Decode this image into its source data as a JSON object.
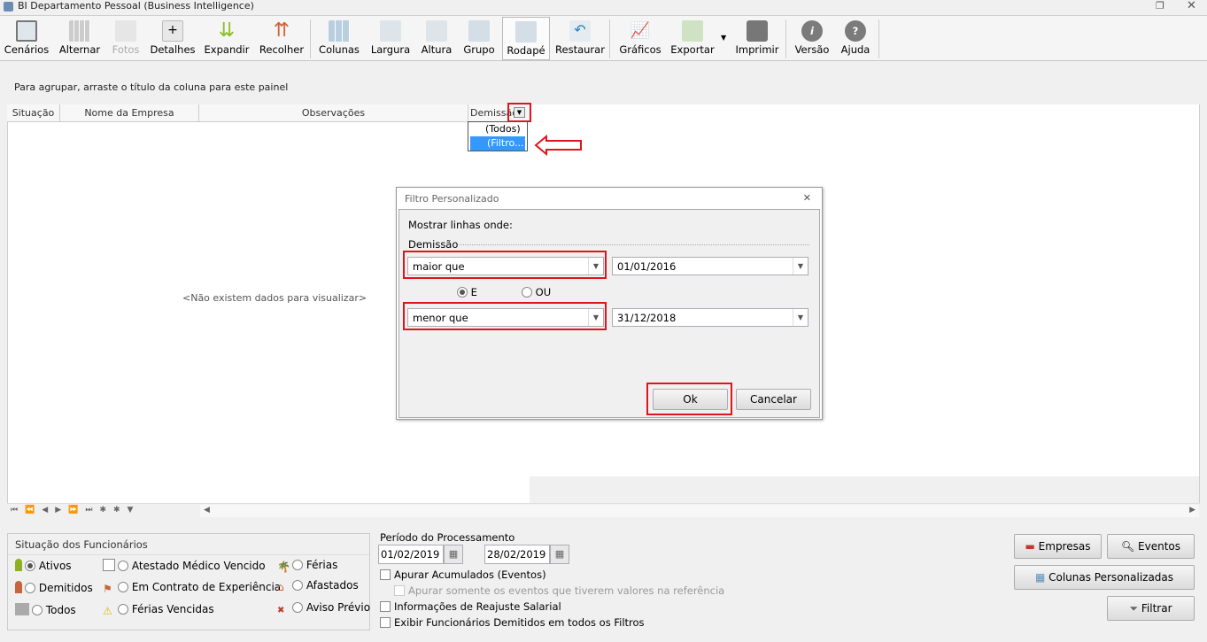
{
  "window": {
    "title": "BI Departamento Pessoal  (Business Intelligence)"
  },
  "toolbar": [
    {
      "label": "Cenários",
      "icon": "scenarios-icon"
    },
    {
      "label": "Alternar",
      "icon": "switch-icon"
    },
    {
      "label": "Fotos",
      "icon": "photos-icon"
    },
    {
      "label": "Detalhes",
      "icon": "details-icon"
    },
    {
      "label": "Expandir",
      "icon": "expand-icon"
    },
    {
      "label": "Recolher",
      "icon": "collapse-icon"
    },
    {
      "label": "Colunas",
      "icon": "columns-icon"
    },
    {
      "label": "Largura",
      "icon": "width-icon"
    },
    {
      "label": "Altura",
      "icon": "height-icon"
    },
    {
      "label": "Grupo",
      "icon": "group-icon"
    },
    {
      "label": "Rodapé",
      "icon": "footer-icon"
    },
    {
      "label": "Restaurar",
      "icon": "restore-icon"
    },
    {
      "label": "Gráficos",
      "icon": "charts-icon"
    },
    {
      "label": "Exportar",
      "icon": "export-icon"
    },
    {
      "label": "Imprimir",
      "icon": "print-icon"
    },
    {
      "label": "Versão",
      "icon": "info-icon"
    },
    {
      "label": "Ajuda",
      "icon": "help-icon"
    }
  ],
  "grid": {
    "group_hint": "Para agrupar, arraste o título da coluna para este painel",
    "columns": [
      "Situação",
      "Nome da Empresa",
      "Observações",
      "Demissão"
    ],
    "empty": "<Não existem dados para visualizar>",
    "filter_dropdown": [
      "(Todos)",
      "(Filtro...)"
    ]
  },
  "dialog": {
    "title": "Filtro Personalizado",
    "close": "✕",
    "prompt": "Mostrar linhas onde:",
    "field": "Demissão",
    "cond1_op": "maior que",
    "cond1_value": "01/01/2016",
    "and_label": "E",
    "or_label": "OU",
    "cond2_op": "menor que",
    "cond2_value": "31/12/2018",
    "ok": "Ok",
    "cancel": "Cancelar"
  },
  "situacao": {
    "title": "Situação dos Funcionários",
    "options": [
      "Ativos",
      "Demitidos",
      "Todos",
      "Atestado Médico Vencido",
      "Em Contrato de Experiência",
      "Férias Vencidas",
      "Férias",
      "Afastados",
      "Aviso Prévio"
    ]
  },
  "periodo": {
    "title": "Período do Processamento",
    "start": "01/02/2019",
    "end": "28/02/2019",
    "checks": [
      "Apurar Acumulados (Eventos)",
      "Apurar somente os eventos que tiverem valores na referência",
      "Informações de Reajuste Salarial",
      "Exibir Funcionários Demitidos em todos os Filtros"
    ]
  },
  "buttons": {
    "empresas": "Empresas",
    "eventos": "Eventos",
    "colunas": "Colunas Personalizadas",
    "filtrar": "Filtrar"
  },
  "colors": {
    "accent": "#3399ff",
    "highlight": "#e0141c"
  }
}
